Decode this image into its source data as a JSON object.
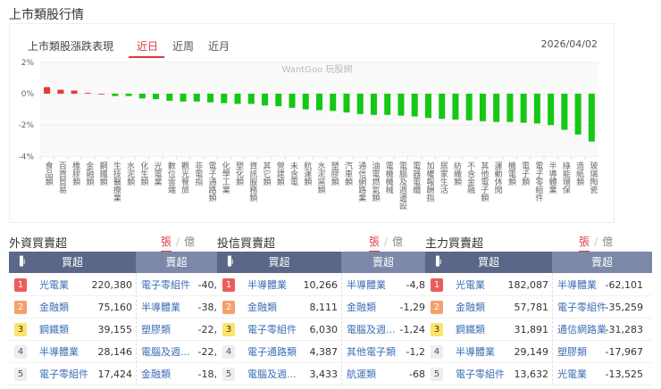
{
  "page_title": "上市類股行情",
  "chart_panel": {
    "title": "上市類股漲跌表現",
    "tabs": [
      "近日",
      "近周",
      "近月"
    ],
    "active_tab": "近日",
    "date": "2026/04/02",
    "watermark": "WantGoo 玩股網"
  },
  "colors": {
    "up": "#e53935",
    "down": "#14c814",
    "accent": "#e0383e"
  },
  "chart_data": {
    "type": "bar",
    "title": "上市類股漲跌表現",
    "ylabel": "%",
    "ylim": [
      -4,
      2
    ],
    "yticks": [
      "2%",
      "0%",
      "-2%",
      "-4%"
    ],
    "ytick_values": [
      2,
      0,
      -2,
      -4
    ],
    "categories": [
      "食品類",
      "百貨貿易",
      "橡膠類",
      "金融類",
      "鋼鐵類",
      "生技醫療業",
      "水泥類",
      "化生類",
      "光電業",
      "數位雲端",
      "觀光餐旅",
      "非電指",
      "電子通路類",
      "化學工業",
      "塑化類",
      "資訊服務類",
      "其它類",
      "營建類",
      "未含電",
      "航運類",
      "水泥窯類",
      "塑膠類",
      "汽車類",
      "通信網路業",
      "油電燃氣類",
      "電機機械",
      "電腦及週邊設",
      "電器電纜",
      "加權報酬指",
      "居家生活",
      "紡織類",
      "不含金融",
      "其他電子類",
      "運動休閒",
      "機電類",
      "電子類",
      "電子零組件",
      "半導體業",
      "綠能環保",
      "造紙類",
      "玻璃陶瓷"
    ],
    "values": [
      0.42,
      0.25,
      0.2,
      0.05,
      0,
      -0.15,
      -0.15,
      -0.3,
      -0.35,
      -0.45,
      -0.5,
      -0.5,
      -0.55,
      -0.6,
      -0.65,
      -0.65,
      -0.75,
      -0.8,
      -0.9,
      -1.0,
      -1.05,
      -1.1,
      -1.2,
      -1.3,
      -1.35,
      -1.35,
      -1.4,
      -1.45,
      -1.55,
      -1.6,
      -1.65,
      -1.7,
      -1.75,
      -1.8,
      -1.8,
      -1.85,
      -1.9,
      -2.0,
      -2.3,
      -2.6,
      -3.05
    ]
  },
  "sections": [
    {
      "title": "外資買賣超",
      "unit_on": "張",
      "unit_off": "億",
      "buy_header": "買超",
      "sell_header": "賣超",
      "buy": [
        {
          "rank": "1",
          "name": "光電業",
          "value": "220,380"
        },
        {
          "rank": "2",
          "name": "金融類",
          "value": "75,160"
        },
        {
          "rank": "3",
          "name": "鋼鐵類",
          "value": "39,155"
        },
        {
          "rank": "4",
          "name": "半導體業",
          "value": "28,146"
        },
        {
          "rank": "5",
          "name": "電子零組件",
          "value": "17,424"
        }
      ],
      "sell": [
        {
          "name": "電子零組件",
          "value": "-40,"
        },
        {
          "name": "半導體業",
          "value": "-38,"
        },
        {
          "name": "塑膠類",
          "value": "-22,"
        },
        {
          "name": "電腦及週...",
          "value": "-22,"
        },
        {
          "name": "金融類",
          "value": "-18,"
        }
      ]
    },
    {
      "title": "投信買賣超",
      "unit_on": "張",
      "unit_off": "億",
      "buy_header": "買超",
      "sell_header": "賣超",
      "buy": [
        {
          "rank": "1",
          "name": "半導體業",
          "value": "10,266"
        },
        {
          "rank": "2",
          "name": "金融類",
          "value": "8,111"
        },
        {
          "rank": "3",
          "name": "電子零組件",
          "value": "6,030"
        },
        {
          "rank": "4",
          "name": "電子通路類",
          "value": "4,387"
        },
        {
          "rank": "5",
          "name": "電腦及週...",
          "value": "3,433"
        }
      ],
      "sell": [
        {
          "name": "半導體業",
          "value": "-4,8"
        },
        {
          "name": "金融類",
          "value": "-1,29"
        },
        {
          "name": "電腦及週...",
          "value": "-1,24"
        },
        {
          "name": "其他電子類",
          "value": "-1,2"
        },
        {
          "name": "航運類",
          "value": "-68"
        }
      ]
    },
    {
      "title": "主力買賣超",
      "unit_on": "張",
      "unit_off": "億",
      "buy_header": "買超",
      "sell_header": "賣超",
      "buy": [
        {
          "rank": "1",
          "name": "光電業",
          "value": "182,087"
        },
        {
          "rank": "2",
          "name": "金融類",
          "value": "57,781"
        },
        {
          "rank": "3",
          "name": "鋼鐵類",
          "value": "31,891"
        },
        {
          "rank": "4",
          "name": "半導體業",
          "value": "29,149"
        },
        {
          "rank": "5",
          "name": "電子零組件",
          "value": "13,632"
        }
      ],
      "sell": [
        {
          "name": "半導體業",
          "value": "-62,101"
        },
        {
          "name": "電子零組件",
          "value": "-35,259"
        },
        {
          "name": "通信網路業",
          "value": "-31,283"
        },
        {
          "name": "塑膠類",
          "value": "-17,967"
        },
        {
          "name": "光電業",
          "value": "-13,525"
        }
      ]
    }
  ]
}
